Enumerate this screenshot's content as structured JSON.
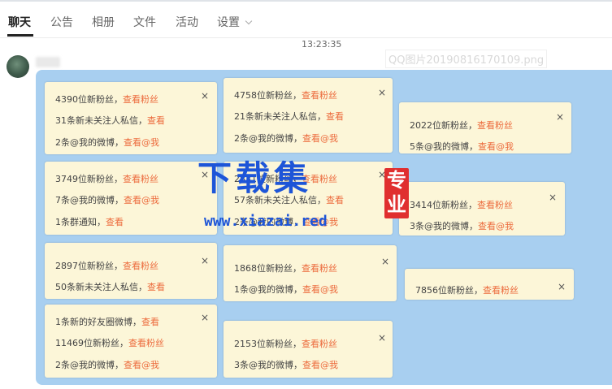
{
  "tabs": [
    {
      "label": "聊天",
      "active": true
    },
    {
      "label": "公告",
      "active": false
    },
    {
      "label": "相册",
      "active": false
    },
    {
      "label": "文件",
      "active": false
    },
    {
      "label": "活动",
      "active": false
    },
    {
      "label": "设置",
      "active": false
    }
  ],
  "chat": {
    "timestamp": "13:23:35",
    "image_filename": "QQ图片20190816170109.png"
  },
  "cards": [
    {
      "lines": [
        {
          "text": "4390位新粉丝，",
          "link": "查看粉丝"
        },
        {
          "text": "31条新未关注人私信，",
          "link": "查看"
        },
        {
          "text": "2条@我的微博，",
          "link": "查看@我"
        }
      ],
      "close": "×"
    },
    {
      "lines": [
        {
          "text": "4758位新粉丝，",
          "link": "查看粉丝"
        },
        {
          "text": "21条新未关注人私信，",
          "link": "查看"
        },
        {
          "text": "2条@我的微博，",
          "link": "查看@我"
        }
      ],
      "close": "×"
    },
    {
      "lines": [
        {
          "text": "2022位新粉丝，",
          "link": "查看粉丝"
        },
        {
          "text": "5条@我的微博，",
          "link": "查看@我"
        }
      ],
      "close": "×"
    },
    {
      "lines": [
        {
          "text": "3749位新粉丝，",
          "link": "查看粉丝"
        },
        {
          "text": "7条@我的微博，",
          "link": "查看@我"
        },
        {
          "text": "1条群通知，",
          "link": "查看"
        }
      ],
      "close": "×"
    },
    {
      "lines": [
        {
          "text": "2831位新粉丝，",
          "link": "查看粉丝"
        },
        {
          "text": "57条新未关注人私信，",
          "link": "查看"
        },
        {
          "text": "2条@我的微博，",
          "link": "查看@我"
        }
      ],
      "close": "×"
    },
    {
      "lines": [
        {
          "text": "3414位新粉丝，",
          "link": "查看粉丝"
        },
        {
          "text": "3条@我的微博，",
          "link": "查看@我"
        }
      ],
      "close": "×"
    },
    {
      "lines": [
        {
          "text": "2897位新粉丝，",
          "link": "查看粉丝"
        },
        {
          "text": "50条新未关注人私信，",
          "link": "查看"
        }
      ],
      "close": "×"
    },
    {
      "lines": [
        {
          "text": "1868位新粉丝，",
          "link": "查看粉丝"
        },
        {
          "text": "1条@我的微博，",
          "link": "查看@我"
        }
      ],
      "close": "×"
    },
    {
      "lines": [
        {
          "text": "7856位新粉丝，",
          "link": "查看粉丝"
        }
      ],
      "close": "×"
    },
    {
      "lines": [
        {
          "text": "1条新的好友圈微博，",
          "link": "查看"
        },
        {
          "text": "11469位新粉丝，",
          "link": "查看粉丝"
        },
        {
          "text": "2条@我的微博，",
          "link": "查看@我"
        }
      ],
      "close": "×"
    },
    {
      "lines": [
        {
          "text": "2153位新粉丝，",
          "link": "查看粉丝"
        },
        {
          "text": "3条@我的微博，",
          "link": "查看@我"
        }
      ],
      "close": "×"
    }
  ],
  "watermark": {
    "title": "下载集",
    "seal": "专业",
    "url": "www.xiazai.red"
  },
  "colors": {
    "bubble": "#a8cff0",
    "card": "#fcf6d8",
    "link": "#ec6a3c",
    "watermark": "#1d55d8",
    "seal": "#e02f2f"
  }
}
